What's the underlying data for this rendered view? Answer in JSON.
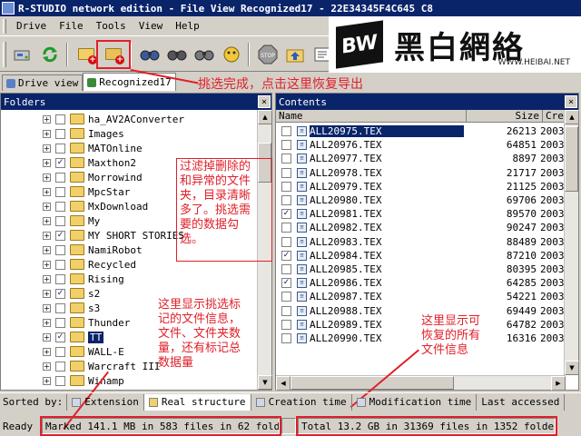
{
  "window": {
    "title": "R-STUDIO network edition - File View Recognized17 - 22E34345F4C645 C8"
  },
  "menu": [
    "Drive",
    "File",
    "Tools",
    "View",
    "Help"
  ],
  "toolbar_icons": [
    "drive-scan-icon",
    "refresh-icon",
    "recover-icon",
    "recover-marked-icon",
    "binoculars-icon",
    "find-next-icon",
    "find-prev-icon",
    "mask-icon",
    "stop-icon",
    "up-folder-icon",
    "properties-icon"
  ],
  "logo": {
    "mark": "BW",
    "name": "黑白網絡",
    "url": "WWW.HEIBAI.NET"
  },
  "tabs": [
    {
      "label": "Drive view"
    },
    {
      "label": "Recognized17"
    }
  ],
  "annotations": {
    "top": "挑选完成，点击这里恢复导出",
    "filter": "过滤掉删除的\n和异常的文件\n夹，目录清晰\n多了。挑选需\n要的数据勾\n选。",
    "marked": "这里显示挑选标\n记的文件信息，\n文件、文件夹数\n量，还有标记总\n数据量",
    "total": "这里显示可\n恢复的所有\n文件信息"
  },
  "folders": {
    "title": "Folders",
    "close": "×",
    "items": [
      {
        "name": "ha_AV2AConverter",
        "checked": false
      },
      {
        "name": "Images",
        "checked": false
      },
      {
        "name": "MATOnline",
        "checked": false
      },
      {
        "name": "Maxthon2",
        "checked": true
      },
      {
        "name": "Morrowind",
        "checked": false
      },
      {
        "name": "MpcStar",
        "checked": false
      },
      {
        "name": "MxDownload",
        "checked": false
      },
      {
        "name": "My",
        "checked": false
      },
      {
        "name": "MY SHORT STORIES",
        "checked": true
      },
      {
        "name": "NamiRobot",
        "checked": false
      },
      {
        "name": "Recycled",
        "checked": false
      },
      {
        "name": "Rising",
        "checked": false
      },
      {
        "name": "s2",
        "checked": true
      },
      {
        "name": "s3",
        "checked": false
      },
      {
        "name": "Thunder",
        "checked": false
      },
      {
        "name": "TT",
        "checked": true
      },
      {
        "name": "WALL-E",
        "checked": false
      },
      {
        "name": "Warcraft III",
        "checked": false
      },
      {
        "name": "Winamp",
        "checked": false
      }
    ]
  },
  "contents": {
    "title": "Contents",
    "close": "×",
    "columns": [
      "Name",
      "Size",
      "Crea"
    ],
    "rows": [
      {
        "name": "ALL20975.TEX",
        "size": "26213",
        "created": "2003",
        "checked": false
      },
      {
        "name": "ALL20976.TEX",
        "size": "64851",
        "created": "2003",
        "checked": false
      },
      {
        "name": "ALL20977.TEX",
        "size": "8897",
        "created": "2003",
        "checked": false
      },
      {
        "name": "ALL20978.TEX",
        "size": "21717",
        "created": "2003",
        "checked": false
      },
      {
        "name": "ALL20979.TEX",
        "size": "21125",
        "created": "2003",
        "checked": false
      },
      {
        "name": "ALL20980.TEX",
        "size": "69706",
        "created": "2003",
        "checked": false
      },
      {
        "name": "ALL20981.TEX",
        "size": "89570",
        "created": "2003",
        "checked": true
      },
      {
        "name": "ALL20982.TEX",
        "size": "90247",
        "created": "2003",
        "checked": false
      },
      {
        "name": "ALL20983.TEX",
        "size": "88489",
        "created": "2003",
        "checked": false
      },
      {
        "name": "ALL20984.TEX",
        "size": "87210",
        "created": "2003",
        "checked": true
      },
      {
        "name": "ALL20985.TEX",
        "size": "80395",
        "created": "2003",
        "checked": false
      },
      {
        "name": "ALL20986.TEX",
        "size": "64285",
        "created": "2003",
        "checked": true
      },
      {
        "name": "ALL20987.TEX",
        "size": "54221",
        "created": "2003",
        "checked": false
      },
      {
        "name": "ALL20988.TEX",
        "size": "69449",
        "created": "2003",
        "checked": false
      },
      {
        "name": "ALL20989.TEX",
        "size": "64782",
        "created": "2003",
        "checked": false
      },
      {
        "name": "ALL20990.TEX",
        "size": "16316",
        "created": "2003",
        "checked": false
      }
    ]
  },
  "sortbar": {
    "label": "Sorted by:",
    "tabs": [
      "Extension",
      "Real structure",
      "Creation time",
      "Modification time",
      "Last accessed"
    ]
  },
  "status": {
    "ready": "Ready",
    "marked": "Marked 141.1 MB in 583 files in 62 folders",
    "total": "Total 13.2 GB in 31369 files in 1352 folders"
  },
  "colors": {
    "accent": "#0a246a",
    "annotation": "#e0202a",
    "window_bg": "#d4d0c8"
  }
}
